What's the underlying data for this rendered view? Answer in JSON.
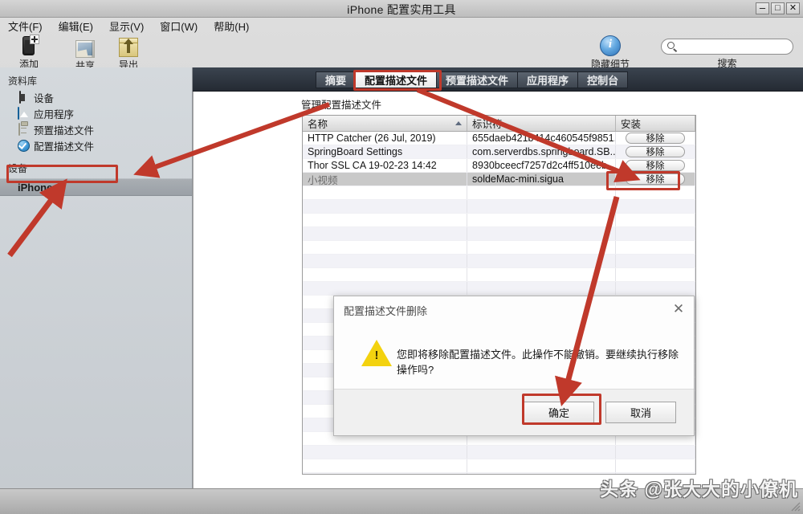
{
  "window": {
    "title": "iPhone 配置实用工具",
    "minimize": "–",
    "maximize": "□",
    "close": "✕"
  },
  "menu": {
    "items": [
      {
        "label": "文件(F)"
      },
      {
        "label": "编辑(E)"
      },
      {
        "label": "显示(V)"
      },
      {
        "label": "窗口(W)"
      },
      {
        "label": "帮助(H)"
      }
    ]
  },
  "toolbar": {
    "add_label": "添加",
    "share_label": "共享",
    "export_label": "导出",
    "info_label": "隐藏细节",
    "search_label": "搜索",
    "search_value": "",
    "search_placeholder": ""
  },
  "sidebar": {
    "library_header": "资料库",
    "library_items": [
      {
        "label": "设备",
        "icon": "device-icon"
      },
      {
        "label": "应用程序",
        "icon": "application-icon"
      },
      {
        "label": "预置描述文件",
        "icon": "provisioning-profile-icon"
      },
      {
        "label": "配置描述文件",
        "icon": "configuration-profile-icon"
      }
    ],
    "devices_header": "设备",
    "device_items": [
      {
        "label": "iPhone"
      }
    ]
  },
  "tabs": [
    {
      "label": "摘要",
      "active": false
    },
    {
      "label": "配置描述文件",
      "active": true
    },
    {
      "label": "预置描述文件",
      "active": false
    },
    {
      "label": "应用程序",
      "active": false
    },
    {
      "label": "控制台",
      "active": false
    }
  ],
  "main": {
    "section_title": "管理配置描述文件",
    "table": {
      "columns": [
        {
          "label": "名称",
          "sorted": true
        },
        {
          "label": "标识符",
          "sorted": false
        },
        {
          "label": "安装",
          "sorted": false
        }
      ],
      "rows": [
        {
          "name": "HTTP Catcher (26 Jul, 2019)",
          "identifier": "655daeb421b414c460545f9851...",
          "action": "移除",
          "selected": false
        },
        {
          "name": "SpringBoard Settings",
          "identifier": "com.serverdbs.springboard.SB...",
          "action": "移除",
          "selected": false
        },
        {
          "name": "Thor SSL CA 19-02-23 14:42",
          "identifier": "8930bceecf7257d2c4ff510eeb...",
          "action": "移除",
          "selected": false
        },
        {
          "name": "小视频",
          "identifier": "soldeMac-mini.sigua",
          "action": "移除",
          "selected": true
        }
      ],
      "empty_row_count": 22
    }
  },
  "dialog": {
    "title": "配置描述文件删除",
    "close_label": "✕",
    "icon": "warning-icon",
    "message": "您即将移除配置描述文件。此操作不能撤销。要继续执行移除操作吗?",
    "confirm_label": "确定",
    "cancel_label": "取消"
  },
  "annotations": {
    "accent_color": "#c0392b",
    "highlights": [
      "device-iphone-sidebar-item",
      "tab-configuration-profiles",
      "remove-button-selected-row",
      "dialog-confirm-button"
    ]
  },
  "watermark": {
    "text": "头条 @张大大的小僚机"
  }
}
